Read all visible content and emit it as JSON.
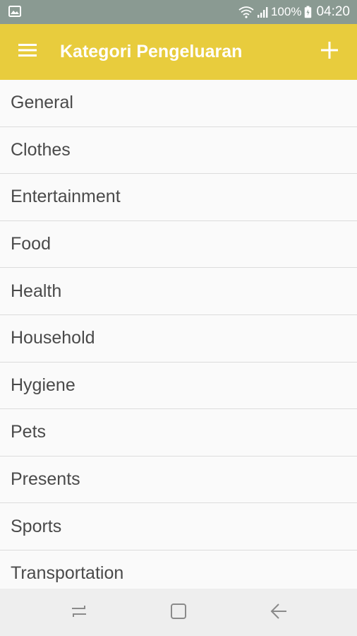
{
  "status_bar": {
    "battery_percent": "100%",
    "time": "04:20",
    "left_icon": "gallery-notification-icon",
    "icons": [
      "wifi-icon",
      "signal-icon",
      "battery-icon"
    ]
  },
  "app_bar": {
    "title": "Kategori Pengeluaran",
    "menu_icon": "hamburger-menu-icon",
    "add_icon": "plus-icon",
    "color": "#e8cc3d"
  },
  "categories": [
    {
      "label": "General"
    },
    {
      "label": "Clothes"
    },
    {
      "label": "Entertainment"
    },
    {
      "label": "Food"
    },
    {
      "label": "Health"
    },
    {
      "label": "Household"
    },
    {
      "label": "Hygiene"
    },
    {
      "label": "Pets"
    },
    {
      "label": "Presents"
    },
    {
      "label": "Sports"
    },
    {
      "label": "Transportation"
    }
  ],
  "nav_bar": {
    "icons": [
      "recent-apps-icon",
      "home-icon",
      "back-icon"
    ]
  }
}
